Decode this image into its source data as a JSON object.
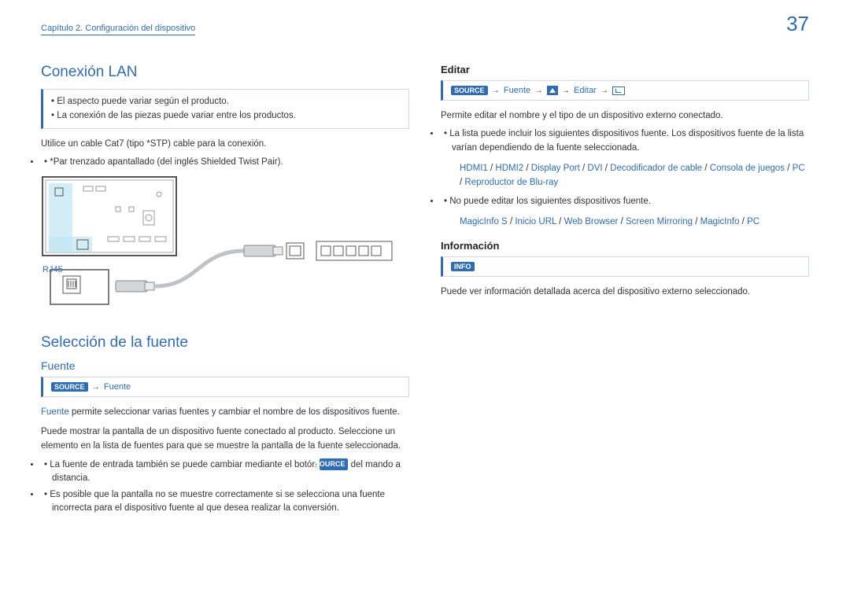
{
  "header": {
    "chapter": "Capítulo 2. Configuración del dispositivo",
    "pageNumber": "37"
  },
  "left": {
    "h1_lan": "Conexión LAN",
    "lan_notes": [
      "El aspecto puede variar según el producto.",
      "La conexión de las piezas puede variar entre los productos."
    ],
    "lan_p1": "Utilice un cable Cat7 (tipo *STP) cable para la conexión.",
    "lan_li1": "*Par trenzado apantallado (del inglés Shielded Twist Pair).",
    "rj45": "RJ45",
    "h1_sel": "Selección de la fuente",
    "h2_fuente": "Fuente",
    "path_fuente_source": "SOURCE",
    "path_fuente_label": "Fuente",
    "fuente_p1_strong": "Fuente",
    "fuente_p1_rest": " permite seleccionar varias fuentes y cambiar el nombre de los dispositivos fuente.",
    "fuente_p2": "Puede mostrar la pantalla de un dispositivo fuente conectado al producto. Seleccione un elemento en la lista de fuentes para que se muestre la pantalla de la fuente seleccionada.",
    "fuente_li1_a": "La fuente de entrada también se puede cambiar mediante el botón ",
    "fuente_li1_tag": "SOURCE",
    "fuente_li1_b": " del mando a distancia.",
    "fuente_li2": "Es posible que la pantalla no se muestre correctamente si se selecciona una fuente incorrecta para el dispositivo fuente al que desea realizar la conversión."
  },
  "right": {
    "h3_editar": "Editar",
    "editar_path_source": "SOURCE",
    "editar_path_fuente": "Fuente",
    "editar_path_editar": "Editar",
    "editar_p1": "Permite editar el nombre y el tipo de un dispositivo externo conectado.",
    "editar_li1": "La lista puede incluir los siguientes dispositivos fuente. Los dispositivos fuente de la lista varían dependiendo de la fuente seleccionada.",
    "devices1": [
      "HDMI1",
      "HDMI2",
      "Display Port",
      "DVI",
      "Decodificador de cable",
      "Consola de juegos",
      "PC",
      "Reproductor de Blu-ray"
    ],
    "editar_li2": "No puede editar los siguientes dispositivos fuente.",
    "devices2": [
      "MagicInfo S",
      "Inicio URL",
      "Web Browser",
      "Screen Mirroring",
      "MagicInfo",
      "PC"
    ],
    "h3_info": "Información",
    "info_tag": "INFO",
    "info_p": "Puede ver información detallada acerca del dispositivo externo seleccionado."
  }
}
